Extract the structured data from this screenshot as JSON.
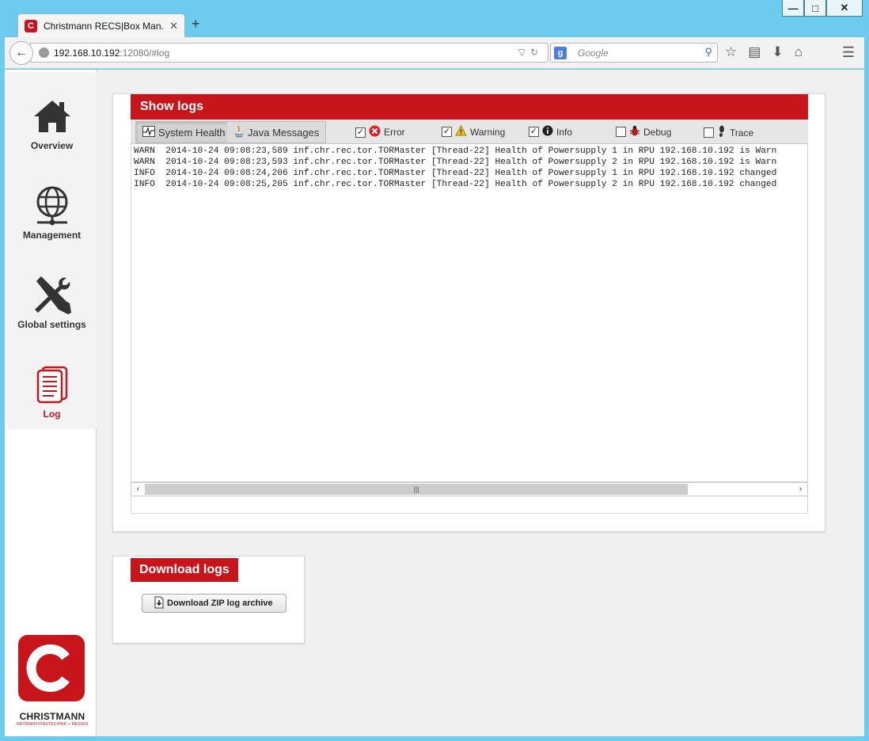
{
  "browser": {
    "tab_title": "Christmann RECS|Box Man...",
    "url_host": "192.168.10.192",
    "url_rest": ":12080/#log",
    "search_placeholder": "Google",
    "favicon_letter": "C"
  },
  "sidebar": {
    "items": [
      {
        "label": "Overview",
        "icon": "home-icon"
      },
      {
        "label": "Management",
        "icon": "globe-network-icon"
      },
      {
        "label": "Global settings",
        "icon": "wrench-screwdriver-icon"
      },
      {
        "label": "Log",
        "icon": "document-icon",
        "active": true
      }
    ],
    "logo": {
      "name": "CHRISTMANN",
      "tagline": "INFORMATIONSTECHNIK + MEDIEN",
      "letter": "C"
    }
  },
  "show_logs": {
    "title": "Show logs",
    "tabs": [
      {
        "label": "System Health",
        "icon": "pulse-icon",
        "selected": true
      },
      {
        "label": "Java Messages",
        "icon": "java-icon",
        "selected": false
      }
    ],
    "filters": [
      {
        "label": "Error",
        "checked": true,
        "icon": "error-icon"
      },
      {
        "label": "Warning",
        "checked": true,
        "icon": "warning-icon"
      },
      {
        "label": "Info",
        "checked": true,
        "icon": "info-icon"
      },
      {
        "label": "Debug",
        "checked": false,
        "icon": "bug-icon"
      },
      {
        "label": "Trace",
        "checked": false,
        "icon": "footprint-icon"
      }
    ],
    "log_lines": [
      "WARN  2014-10-24 09:08:23,589 inf.chr.rec.tor.TORMaster [Thread-22] Health of Powersupply 1 in RPU 192.168.10.192 is Warn",
      "WARN  2014-10-24 09:08:23,593 inf.chr.rec.tor.TORMaster [Thread-22] Health of Powersupply 2 in RPU 192.168.10.192 is Warn",
      "INFO  2014-10-24 09:08:24,206 inf.chr.rec.tor.TORMaster [Thread-22] Health of Powersupply 1 in RPU 192.168.10.192 changed",
      "INFO  2014-10-24 09:08:25,205 inf.chr.rec.tor.TORMaster [Thread-22] Health of Powersupply 2 in RPU 192.168.10.192 changed"
    ]
  },
  "download_logs": {
    "title": "Download logs",
    "button_label": "Download ZIP log archive"
  },
  "colors": {
    "brand_red": "#c8151c",
    "browser_frame": "#6ccbee"
  }
}
